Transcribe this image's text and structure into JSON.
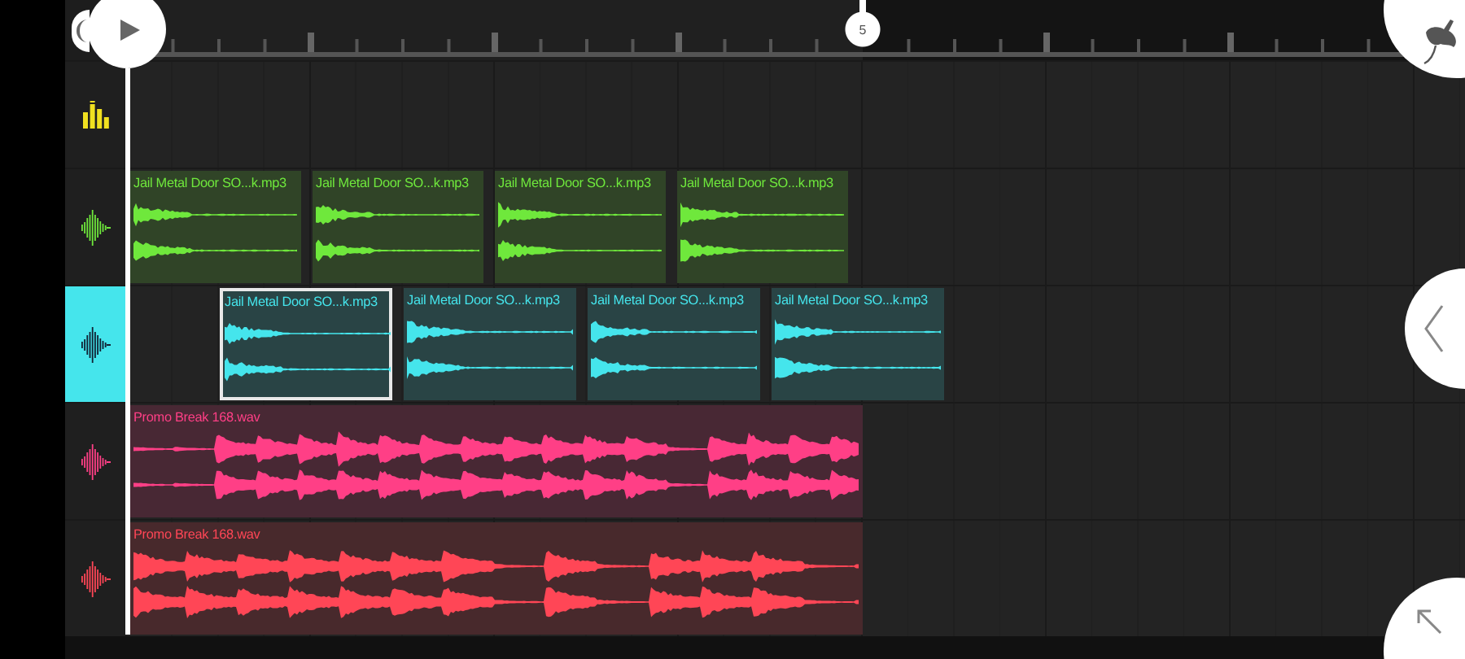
{
  "ruler": {
    "marker": "5"
  },
  "tracks": [
    {
      "kind": "mixer"
    },
    {
      "kind": "audio",
      "color": "#6fe83c",
      "selected": false,
      "clips": [
        {
          "name": "Jail Metal Door SO...k.mp3",
          "selected": false
        },
        {
          "name": "Jail Metal Door SO...k.mp3",
          "selected": false
        },
        {
          "name": "Jail Metal Door SO...k.mp3",
          "selected": false
        },
        {
          "name": "Jail Metal Door SO...k.mp3",
          "selected": false
        }
      ]
    },
    {
      "kind": "audio",
      "color": "#45e5ec",
      "selected": true,
      "clips": [
        {
          "name": "Jail Metal Door SO...k.mp3",
          "selected": true
        },
        {
          "name": "Jail Metal Door SO...k.mp3",
          "selected": false
        },
        {
          "name": "Jail Metal Door SO...k.mp3",
          "selected": false
        },
        {
          "name": "Jail Metal Door SO...k.mp3",
          "selected": false
        }
      ]
    },
    {
      "kind": "audio",
      "color": "#ff3f86",
      "selected": false,
      "clips": [
        {
          "name": "Promo Break 168.wav",
          "selected": false
        }
      ]
    },
    {
      "kind": "audio",
      "color": "#ff4656",
      "selected": false,
      "clips": [
        {
          "name": "Promo Break 168.wav",
          "selected": false
        }
      ]
    }
  ]
}
